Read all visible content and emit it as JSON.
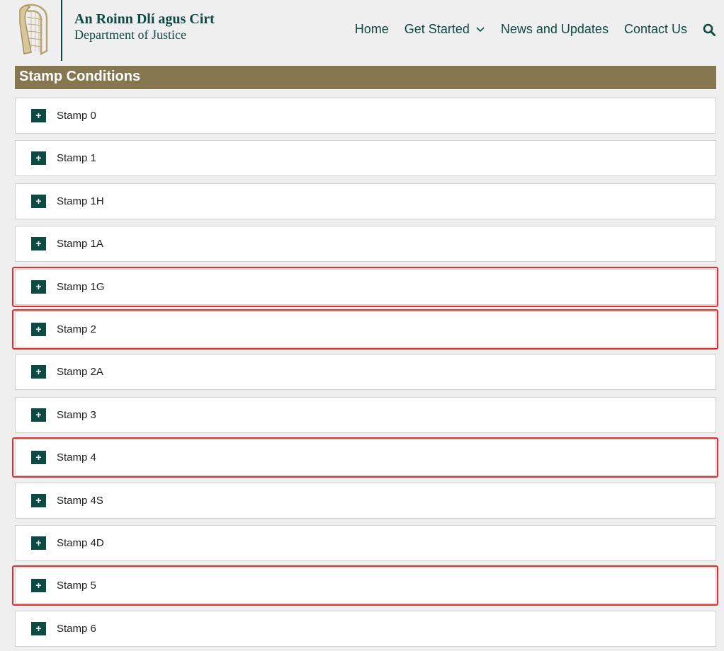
{
  "brand": {
    "line1": "An Roinn Dlí agus Cirt",
    "line2": "Department of Justice",
    "emblem_icon": "harp-icon"
  },
  "nav": {
    "items": [
      {
        "label": "Home"
      },
      {
        "label": "Get Started",
        "has_dropdown": true
      },
      {
        "label": "News and Updates"
      },
      {
        "label": "Contact Us"
      }
    ],
    "search_icon": "search-icon"
  },
  "section": {
    "title": "Stamp Conditions"
  },
  "accordion": {
    "items": [
      {
        "label": "Stamp 0",
        "expand_symbol": "+",
        "highlighted": false
      },
      {
        "label": "Stamp 1",
        "expand_symbol": "+",
        "highlighted": false
      },
      {
        "label": "Stamp 1H",
        "expand_symbol": "+",
        "highlighted": false
      },
      {
        "label": "Stamp 1A",
        "expand_symbol": "+",
        "highlighted": false
      },
      {
        "label": "Stamp 1G",
        "expand_symbol": "+",
        "highlighted": true
      },
      {
        "label": "Stamp 2",
        "expand_symbol": "+",
        "highlighted": true
      },
      {
        "label": "Stamp 2A",
        "expand_symbol": "+",
        "highlighted": false
      },
      {
        "label": "Stamp 3",
        "expand_symbol": "+",
        "highlighted": false
      },
      {
        "label": "Stamp 4",
        "expand_symbol": "+",
        "highlighted": true
      },
      {
        "label": "Stamp 4S",
        "expand_symbol": "+",
        "highlighted": false
      },
      {
        "label": "Stamp 4D",
        "expand_symbol": "+",
        "highlighted": false
      },
      {
        "label": "Stamp 5",
        "expand_symbol": "+",
        "highlighted": true
      },
      {
        "label": "Stamp 6",
        "expand_symbol": "+",
        "highlighted": false
      }
    ]
  },
  "colors": {
    "brand_green": "#0c4a43",
    "section_bar": "#867751",
    "highlight_red": "#e52b2b",
    "background": "#efefef"
  }
}
